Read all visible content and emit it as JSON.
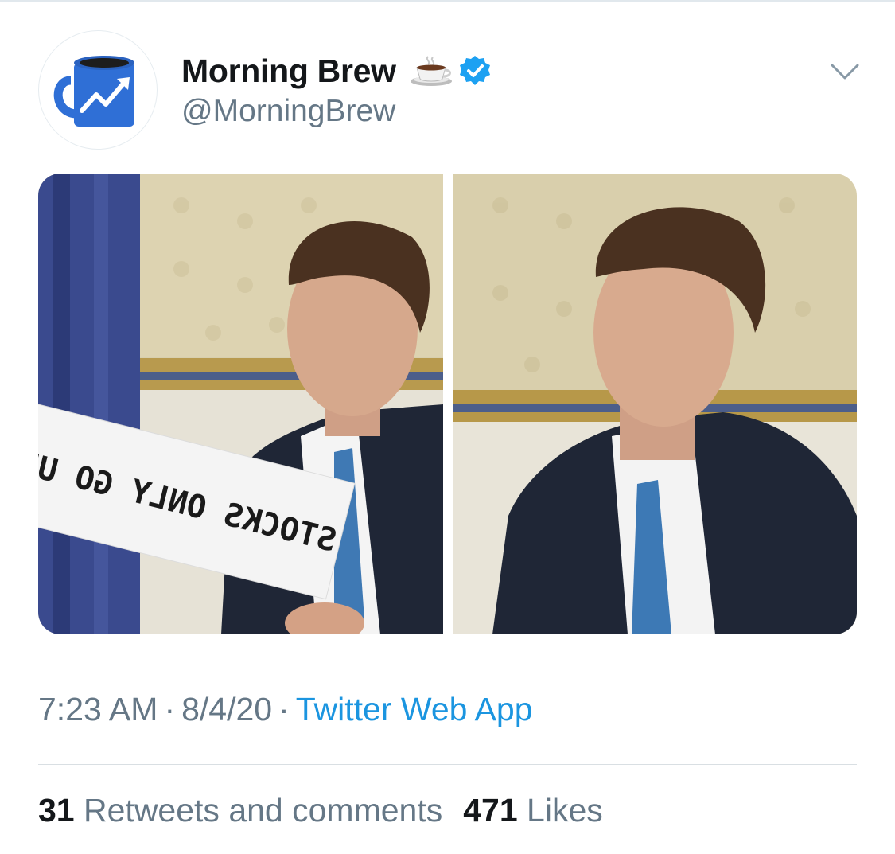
{
  "author": {
    "display_name": "Morning Brew",
    "handle": "@MorningBrew",
    "name_emoji_icon": "coffee-cup-icon",
    "verified_icon": "verified-badge-icon",
    "avatar_icon": "blue-mug-chart-icon"
  },
  "media": {
    "images": [
      {
        "sign_text": "STOCKS ONLY GO UP"
      },
      {}
    ]
  },
  "meta": {
    "time": "7:23 AM",
    "separator": "·",
    "date": "8/4/20",
    "source": "Twitter Web App"
  },
  "stats": {
    "retweets_count": "31",
    "retweets_label": "Retweets and comments",
    "likes_count": "471",
    "likes_label": "Likes"
  },
  "colors": {
    "brand_blue": "#1b95e0",
    "verified_blue": "#1da1f2",
    "secondary_text": "#657786",
    "primary_text": "#14171a",
    "mug_blue": "#2f6fd6"
  }
}
